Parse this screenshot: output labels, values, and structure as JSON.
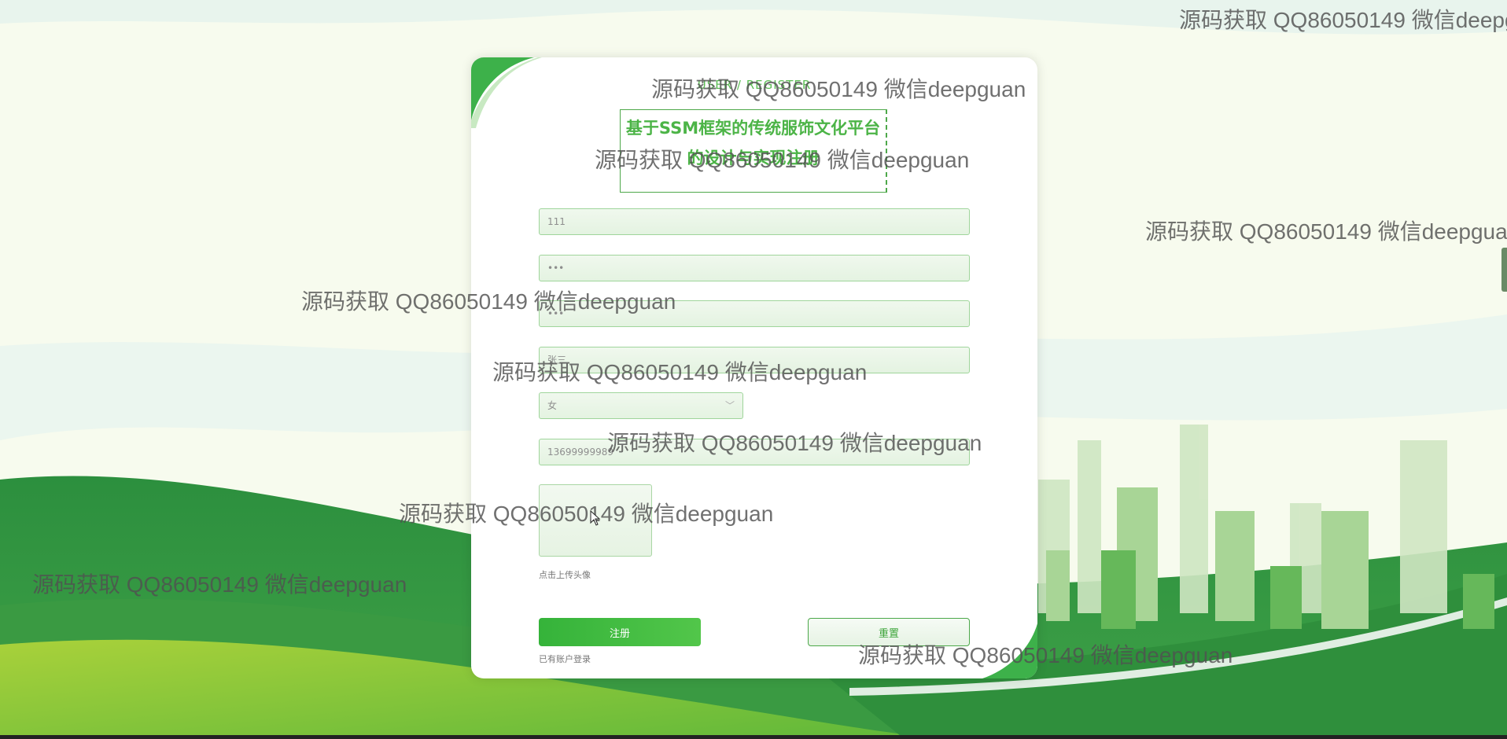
{
  "page": {
    "subtitle": "USER / REGISTER",
    "title": "基于SSM框架的传统服饰文化平台的设计与实现注册"
  },
  "form": {
    "username_value": "111",
    "password_value": "•••",
    "confirm_password_value": "•••",
    "name_value": "张三",
    "gender_value": "女",
    "phone_value": "13699999989",
    "avatar_label": "点击上传头像",
    "register_label": "注册",
    "reset_label": "重置",
    "login_link": "已有账户登录"
  },
  "watermark": {
    "text": "源码获取 QQ86050149 微信deepguan"
  },
  "icons": {
    "select_arrow": "chevron-down-icon",
    "cursor": "mouse-pointer-icon"
  },
  "colors": {
    "accent": "#4cb447",
    "field_border": "#9fd59b",
    "button": "#3fb83d"
  }
}
